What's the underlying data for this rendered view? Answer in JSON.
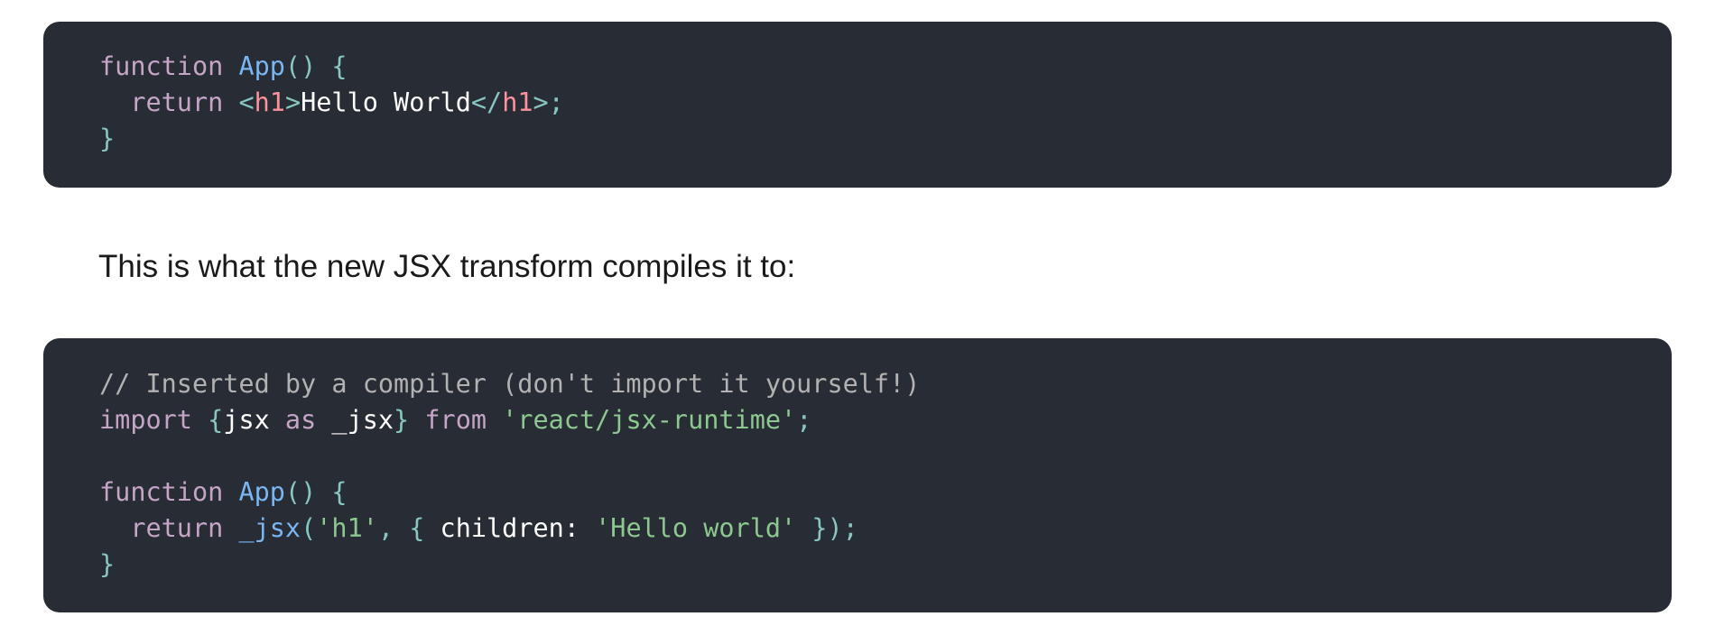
{
  "code_block_1": {
    "lines": [
      [
        {
          "type": "keyword",
          "text": "function "
        },
        {
          "type": "func",
          "text": "App"
        },
        {
          "type": "punct",
          "text": "() {"
        }
      ],
      [
        {
          "type": "keyword",
          "text": "  return "
        },
        {
          "type": "punct",
          "text": "<"
        },
        {
          "type": "tag",
          "text": "h1"
        },
        {
          "type": "punct",
          "text": ">"
        },
        {
          "type": "text",
          "text": "Hello World"
        },
        {
          "type": "punct",
          "text": "</"
        },
        {
          "type": "tag",
          "text": "h1"
        },
        {
          "type": "punct",
          "text": ">;"
        }
      ],
      [
        {
          "type": "punct",
          "text": "}"
        }
      ]
    ]
  },
  "paragraph": {
    "text": "This is what the new JSX transform compiles it to:"
  },
  "code_block_2": {
    "lines": [
      [
        {
          "type": "comment",
          "text": "// Inserted by a compiler (don't import it yourself!)"
        }
      ],
      [
        {
          "type": "keyword",
          "text": "import "
        },
        {
          "type": "punct",
          "text": "{"
        },
        {
          "type": "text",
          "text": "jsx "
        },
        {
          "type": "keyword",
          "text": "as "
        },
        {
          "type": "text",
          "text": "_jsx"
        },
        {
          "type": "punct",
          "text": "} "
        },
        {
          "type": "keyword",
          "text": "from "
        },
        {
          "type": "string",
          "text": "'react/jsx-runtime'"
        },
        {
          "type": "punct",
          "text": ";"
        }
      ],
      [],
      [
        {
          "type": "keyword",
          "text": "function "
        },
        {
          "type": "func",
          "text": "App"
        },
        {
          "type": "punct",
          "text": "() {"
        }
      ],
      [
        {
          "type": "keyword",
          "text": "  return "
        },
        {
          "type": "func",
          "text": "_jsx"
        },
        {
          "type": "punct",
          "text": "("
        },
        {
          "type": "string",
          "text": "'h1'"
        },
        {
          "type": "punct",
          "text": ", { "
        },
        {
          "type": "text",
          "text": "children: "
        },
        {
          "type": "string",
          "text": "'Hello world'"
        },
        {
          "type": "punct",
          "text": " });"
        }
      ],
      [
        {
          "type": "punct",
          "text": "}"
        }
      ]
    ]
  },
  "colors": {
    "code_background": "#282c34",
    "keyword": "#c5a5c5",
    "function": "#79b6f2",
    "punctuation": "#88c6be",
    "tag": "#fc929e",
    "plain_text": "#ffffff",
    "string": "#8dc891",
    "comment": "#b2b2b2",
    "prose_text": "#1a1a1a"
  }
}
